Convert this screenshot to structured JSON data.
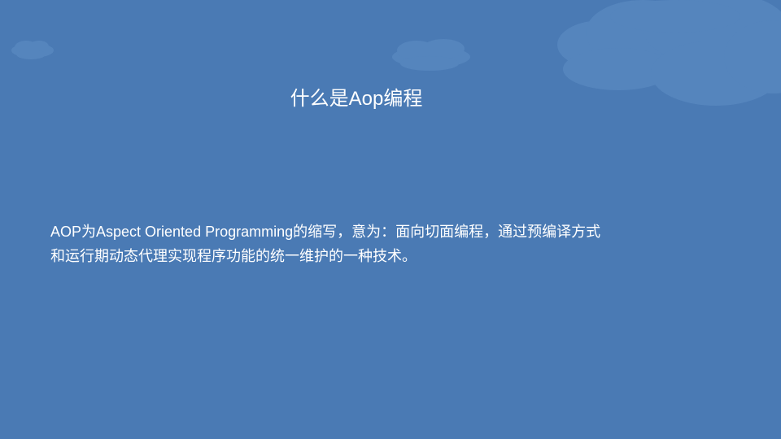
{
  "slide": {
    "title": "什么是Aop编程",
    "body_lines": [
      "AOP为Aspect Oriented Programming的缩写，意为：面向切面编程，通过预编译方式",
      "和运行期动态代理实现程序功能的统一维护的一种技术。"
    ]
  },
  "colors": {
    "background": "#4a7ab4",
    "cloud": "#5585bd",
    "text": "#ffffff"
  }
}
